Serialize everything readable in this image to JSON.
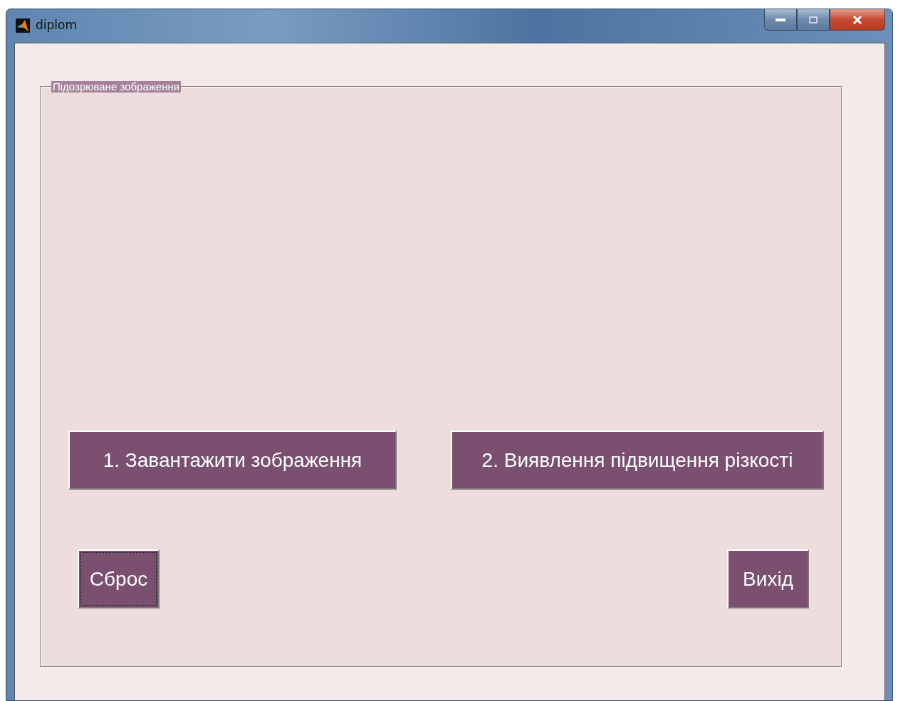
{
  "window": {
    "title": "diplom"
  },
  "panel": {
    "title": "Підозрюване зображення"
  },
  "buttons": [
    {
      "label": "1.  Завантажити зображення",
      "kind": "wide",
      "focused": false
    },
    {
      "label": "2. Виявлення підвищення різкості",
      "kind": "wide",
      "focused": false
    },
    {
      "label": "Сброс",
      "kind": "small",
      "focused": true
    },
    {
      "label": "Вихід",
      "kind": "small",
      "focused": false
    }
  ]
}
